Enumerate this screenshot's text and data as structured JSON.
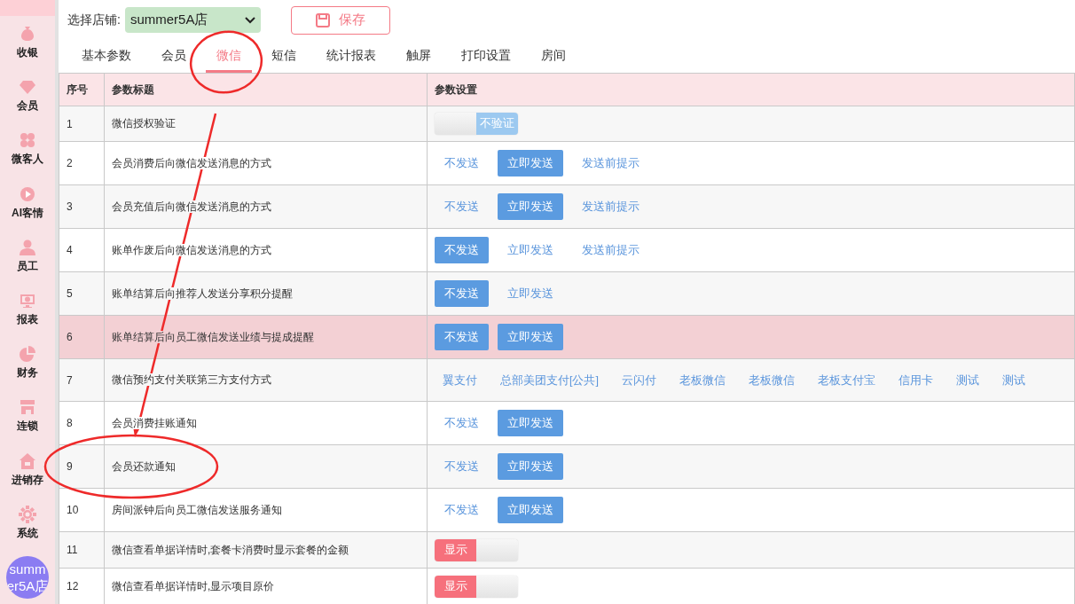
{
  "sidebar": {
    "items": [
      {
        "label": "收银",
        "selected": false
      },
      {
        "label": "会员",
        "selected": false
      },
      {
        "label": "微客人",
        "selected": false
      },
      {
        "label": "AI客情",
        "selected": false
      },
      {
        "label": "员工",
        "selected": false
      },
      {
        "label": "报表",
        "selected": false
      },
      {
        "label": "财务",
        "selected": false
      },
      {
        "label": "连锁",
        "selected": false
      },
      {
        "label": "进销存",
        "selected": false
      },
      {
        "label": "系统",
        "selected": false
      }
    ],
    "avatar": "summer5A店"
  },
  "toolbar": {
    "store_label": "选择店铺:",
    "store": "summer5A店",
    "save": "保存"
  },
  "tabs": [
    {
      "label": "基本参数",
      "selected": false
    },
    {
      "label": "会员",
      "selected": false
    },
    {
      "label": "微信",
      "selected": true
    },
    {
      "label": "短信",
      "selected": false
    },
    {
      "label": "统计报表",
      "selected": false
    },
    {
      "label": "触屏",
      "selected": false
    },
    {
      "label": "打印设置",
      "selected": false
    },
    {
      "label": "房间",
      "selected": false
    }
  ],
  "table": {
    "columns": [
      "序号",
      "参数标题",
      "参数设置"
    ],
    "rows": [
      {
        "no": "1",
        "title": "微信授权验证",
        "highlighted": false,
        "setting": {
          "kind": "toggle",
          "label": "不验证",
          "on": false
        }
      },
      {
        "no": "2",
        "title": "会员消费后向微信发送消息的方式",
        "highlighted": false,
        "setting": {
          "kind": "options",
          "options": [
            {
              "label": "不发送",
              "selected": false
            },
            {
              "label": "立即发送",
              "selected": true
            },
            {
              "label": "发送前提示",
              "selected": false
            }
          ]
        }
      },
      {
        "no": "3",
        "title": "会员充值后向微信发送消息的方式",
        "highlighted": false,
        "setting": {
          "kind": "options",
          "options": [
            {
              "label": "不发送",
              "selected": false
            },
            {
              "label": "立即发送",
              "selected": true
            },
            {
              "label": "发送前提示",
              "selected": false
            }
          ]
        }
      },
      {
        "no": "4",
        "title": "账单作废后向微信发送消息的方式",
        "highlighted": false,
        "setting": {
          "kind": "options",
          "options": [
            {
              "label": "不发送",
              "selected": true
            },
            {
              "label": "立即发送",
              "selected": false
            },
            {
              "label": "发送前提示",
              "selected": false
            }
          ]
        }
      },
      {
        "no": "5",
        "title": "账单结算后向推荐人发送分享积分提醒",
        "highlighted": false,
        "setting": {
          "kind": "options",
          "options": [
            {
              "label": "不发送",
              "selected": true
            },
            {
              "label": "立即发送",
              "selected": false
            }
          ]
        }
      },
      {
        "no": "6",
        "title": "账单结算后向员工微信发送业绩与提成提醒",
        "highlighted": true,
        "setting": {
          "kind": "options",
          "options": [
            {
              "label": "不发送",
              "selected": true
            },
            {
              "label": "立即发送",
              "selected": true
            }
          ]
        }
      },
      {
        "no": "7",
        "title": "微信预约支付关联第三方支付方式",
        "highlighted": false,
        "setting": {
          "kind": "options",
          "options": [
            {
              "label": "翼支付",
              "selected": false
            },
            {
              "label": "总部美团支付[公共]",
              "selected": false
            },
            {
              "label": "云闪付",
              "selected": false
            },
            {
              "label": "老板微信",
              "selected": false
            },
            {
              "label": "老板微信",
              "selected": false
            },
            {
              "label": "老板支付宝",
              "selected": false
            },
            {
              "label": "信用卡",
              "selected": false
            },
            {
              "label": "测试",
              "selected": false
            },
            {
              "label": "测试",
              "selected": false
            }
          ]
        }
      },
      {
        "no": "8",
        "title": "会员消费挂账通知",
        "highlighted": false,
        "setting": {
          "kind": "options",
          "options": [
            {
              "label": "不发送",
              "selected": false
            },
            {
              "label": "立即发送",
              "selected": true
            }
          ]
        }
      },
      {
        "no": "9",
        "title": "会员还款通知",
        "highlighted": false,
        "setting": {
          "kind": "options",
          "options": [
            {
              "label": "不发送",
              "selected": false
            },
            {
              "label": "立即发送",
              "selected": true
            }
          ]
        }
      },
      {
        "no": "10",
        "title": "房间派钟后向员工微信发送服务通知",
        "highlighted": false,
        "setting": {
          "kind": "options",
          "options": [
            {
              "label": "不发送",
              "selected": false
            },
            {
              "label": "立即发送",
              "selected": true
            }
          ]
        }
      },
      {
        "no": "11",
        "title": "微信查看单据详情时,套餐卡消费时显示套餐的金额",
        "highlighted": false,
        "setting": {
          "kind": "toggle",
          "label": "显示",
          "on": true
        }
      },
      {
        "no": "12",
        "title": "微信查看单据详情时,显示项目原价",
        "highlighted": false,
        "setting": {
          "kind": "toggle",
          "label": "显示",
          "on": true
        }
      }
    ]
  },
  "annotations": [
    {
      "kind": "tab-circle"
    },
    {
      "kind": "arrow"
    },
    {
      "kind": "row-circle"
    }
  ]
}
